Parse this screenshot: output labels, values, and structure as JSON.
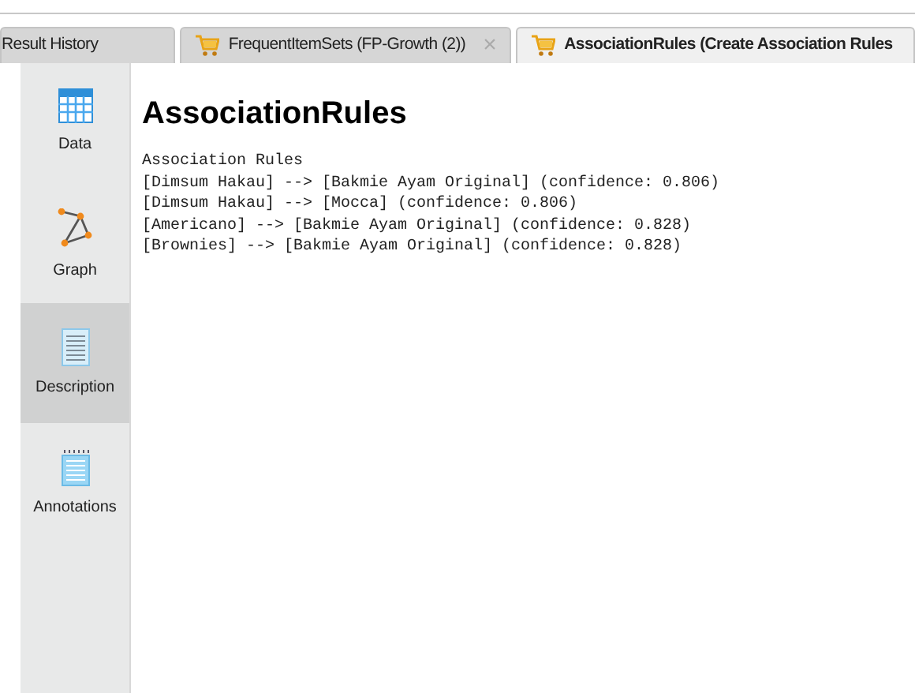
{
  "tabs": [
    {
      "label": "Result History",
      "kind": "plain",
      "selected": false
    },
    {
      "label": "FrequentItemSets (FP-Growth (2))",
      "kind": "cart",
      "selected": false,
      "close": "×"
    },
    {
      "label": "AssociationRules (Create Association Rules",
      "kind": "cart",
      "selected": true
    }
  ],
  "sidebar": {
    "items": [
      {
        "label": "Data",
        "kind": "table",
        "selected": false
      },
      {
        "label": "Graph",
        "kind": "graph",
        "selected": false
      },
      {
        "label": "Description",
        "kind": "description",
        "selected": true
      },
      {
        "label": "Annotations",
        "kind": "annotations",
        "selected": false
      }
    ]
  },
  "content": {
    "title": "AssociationRules",
    "lines": [
      "Association Rules",
      "[Dimsum Hakau] --> [Bakmie Ayam Original] (confidence: 0.806)",
      "[Dimsum Hakau] --> [Mocca] (confidence: 0.806)",
      "[Americano] --> [Bakmie Ayam Original] (confidence: 0.828)",
      "[Brownies] --> [Bakmie Ayam Original] (confidence: 0.828)"
    ]
  }
}
